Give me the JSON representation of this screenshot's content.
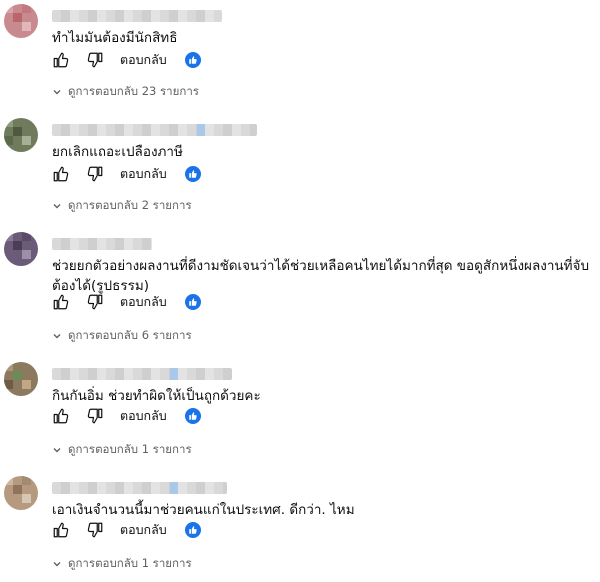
{
  "ui": {
    "reply_label": "ตอบกลับ"
  },
  "comments": [
    {
      "text": "ทำไมมันต้องมีนักสิทธิ",
      "replies": "ดูการตอบกลับ 23 รายการ"
    },
    {
      "text": "ยกเลิกแถอะเปลืองภาษี",
      "replies": "ดูการตอบกลับ 2 รายการ"
    },
    {
      "text": "ช่วยยกตัวอย่างผลงานที่ดีงามชัดเจนว่าได้ช่วยเหลือคนไทยได้มากที่สุด ขอดูสักหนึ่งผลงานที่จับต้องได้(รูปธรรม)",
      "replies": "ดูการตอบกลับ 6 รายการ"
    },
    {
      "text": "กินกันอิ่ม ช่วยทำผิดให้เป็นถูกด้วยคะ",
      "replies": "ดูการตอบกลับ 1 รายการ"
    },
    {
      "text": "เอาเงินจำนวนนี้มาช่วยคนแก่ในประเทศ. ดีกว่า. ไหม",
      "replies": "ดูการตอบกลับ 1 รายการ"
    }
  ],
  "colors": {
    "accent": "#1a73e8",
    "secondary_text": "#606060"
  },
  "icons": [
    "like-icon",
    "dislike-icon",
    "creator-heart-icon",
    "chevron-down-icon"
  ]
}
